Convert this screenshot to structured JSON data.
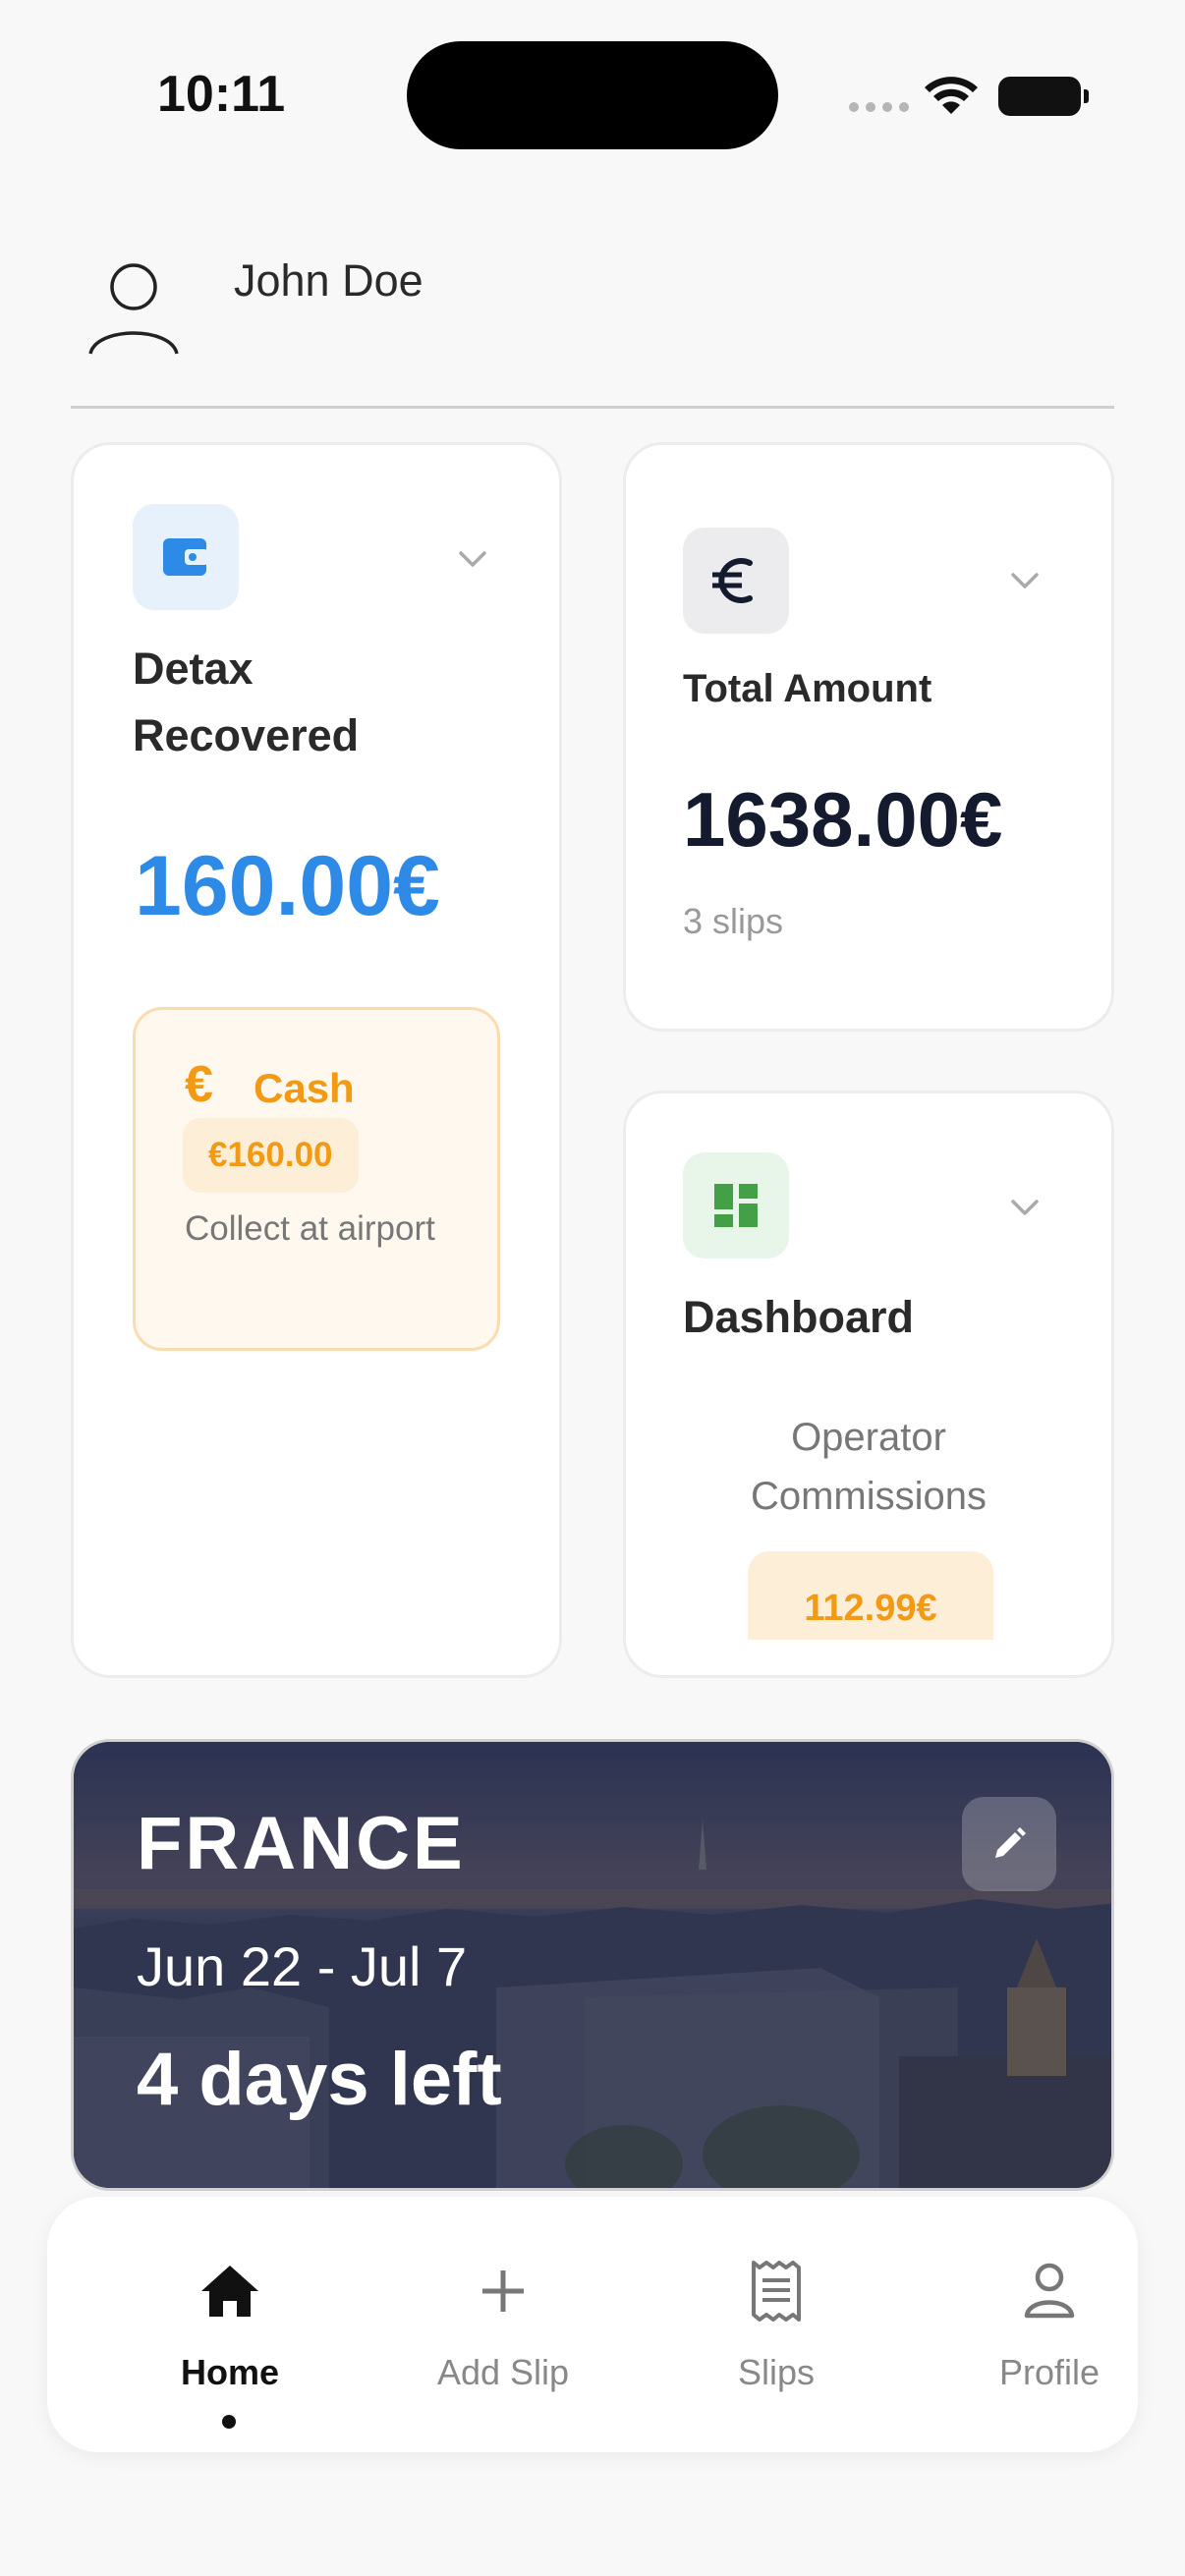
{
  "status_bar": {
    "time": "10:11"
  },
  "user": {
    "name": "John Doe"
  },
  "cards": {
    "detax": {
      "title": "Detax Recovered",
      "amount": "160.00€",
      "icon": "wallet-icon",
      "accent": "#2d8ae6",
      "cash": {
        "symbol": "€",
        "label": "Cash",
        "value": "€160.00",
        "note": "Collect at airport"
      }
    },
    "total": {
      "title": "Total Amount",
      "amount": "1638.00€",
      "slips": "3 slips",
      "icon": "euro-icon"
    },
    "dashboard": {
      "title": "Dashboard",
      "operator_label": "Operator Commissions",
      "operator_value": "112.99€",
      "icon": "dashboard-icon",
      "accent": "#43a047"
    }
  },
  "trip": {
    "country": "FRANCE",
    "dates": "Jun 22 - Jul 7",
    "days_left": "4 days left"
  },
  "tabbar": {
    "active": "Home",
    "items": [
      {
        "label": "Home",
        "icon": "home-icon"
      },
      {
        "label": "Add Slip",
        "icon": "plus-icon"
      },
      {
        "label": "Slips",
        "icon": "receipt-icon"
      },
      {
        "label": "Profile",
        "icon": "person-icon"
      }
    ]
  }
}
